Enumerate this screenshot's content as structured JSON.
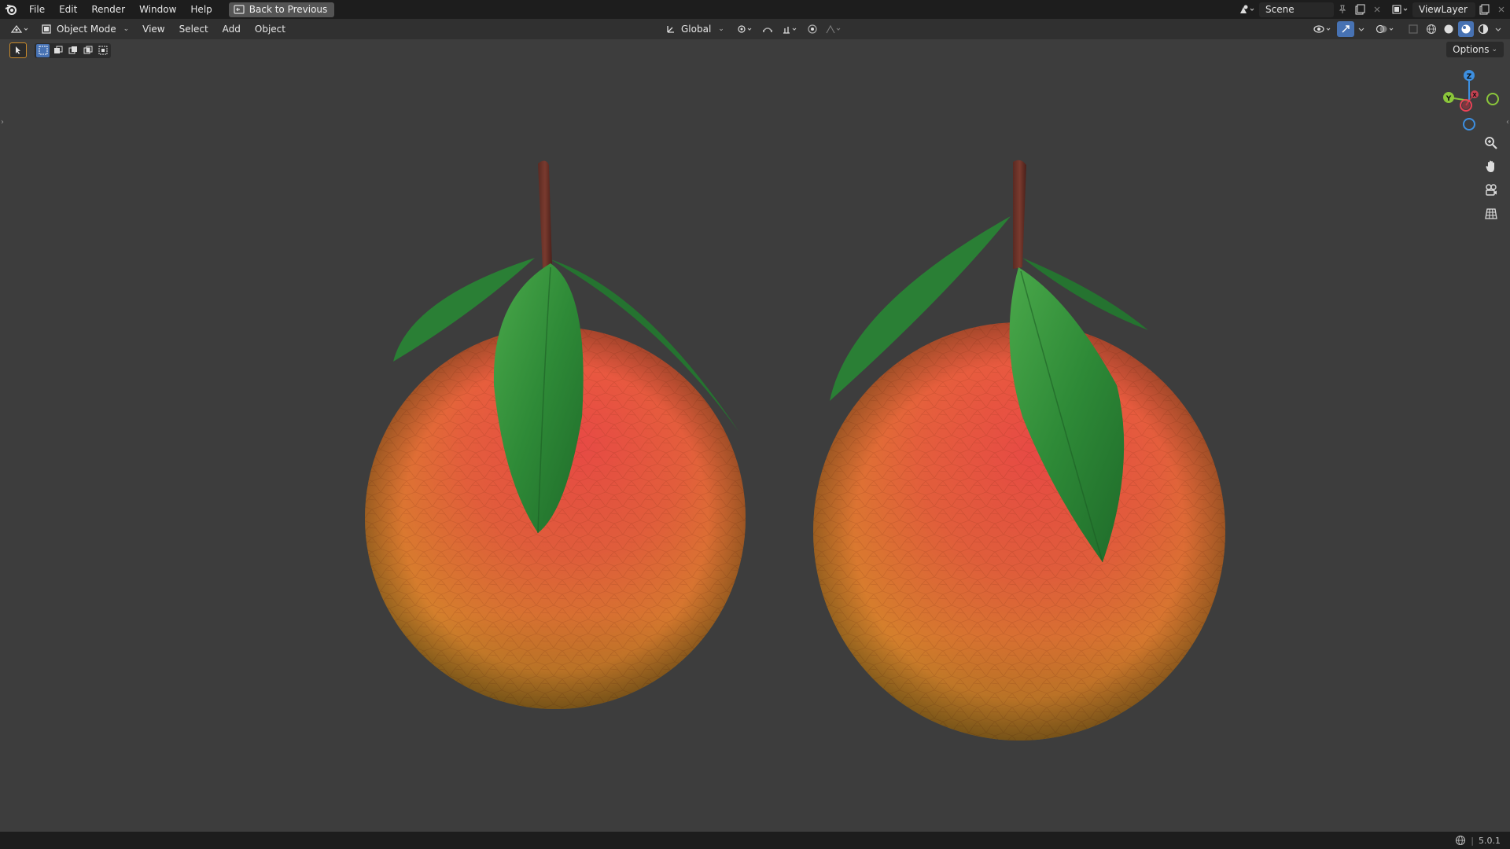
{
  "topbar": {
    "menus": [
      "File",
      "Edit",
      "Render",
      "Window",
      "Help"
    ],
    "back_label": "Back to Previous",
    "scene_name": "Scene",
    "viewlayer_name": "ViewLayer"
  },
  "header": {
    "mode_label": "Object Mode",
    "menus": [
      "View",
      "Select",
      "Add",
      "Object"
    ],
    "transform_orientation": "Global"
  },
  "viewport": {
    "options_label": "Options",
    "gizmo_axes": {
      "z": "Z",
      "y": "Y",
      "x": "X"
    }
  },
  "statusbar": {
    "version": "5.0.1"
  },
  "colors": {
    "accent": "#4772b3",
    "axis_x": "#e94256",
    "axis_y": "#8bc63b",
    "axis_z": "#3d8fe0"
  },
  "icons": [
    "blender-logo-icon",
    "editor-type-icon",
    "object-mode-icon",
    "transform-orientation-icon",
    "pivot-icon",
    "snap-icon",
    "proportional-icon",
    "visibility-icon",
    "gizmo-icon",
    "overlay-icon",
    "xray-icon",
    "wireframe-shading-icon",
    "solid-shading-icon",
    "material-shading-icon",
    "rendered-shading-icon",
    "zoom-icon",
    "pan-hand-icon",
    "camera-view-icon",
    "grid-ortho-icon",
    "network-icon"
  ]
}
